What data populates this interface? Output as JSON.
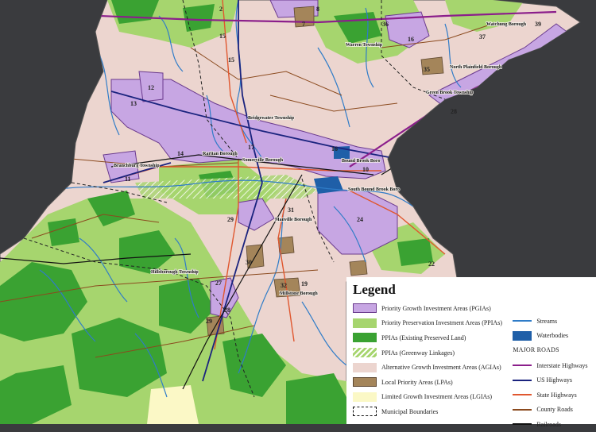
{
  "municipalities": [
    {
      "name": "Warren Township"
    },
    {
      "name": "Watchung Borough"
    },
    {
      "name": "North Plainfield Borough"
    },
    {
      "name": "Green Brook Township"
    },
    {
      "name": "Bridgewater Township"
    },
    {
      "name": "Raritan Borough"
    },
    {
      "name": "Somerville Borough"
    },
    {
      "name": "Bound Brook Boro"
    },
    {
      "name": "South Bound Brook Boro"
    },
    {
      "name": "Branchburg Township"
    },
    {
      "name": "Manville Borough"
    },
    {
      "name": "Hillsborough Township"
    },
    {
      "name": "Millstone Borough"
    }
  ],
  "route_markers": [
    "2",
    "8",
    "7",
    "36",
    "16",
    "37",
    "39",
    "15",
    "15",
    "12",
    "13",
    "35",
    "28",
    "17",
    "16",
    "10",
    "14",
    "11",
    "31",
    "24",
    "29",
    "30",
    "27",
    "32",
    "19",
    "22",
    "28",
    "29"
  ],
  "colors": {
    "pgia": "#c7a6e3",
    "ppia": "#a6d56e",
    "ppia_preserved": "#3aa232",
    "agia": "#ecd5cf",
    "lpa": "#a4855a",
    "lgia": "#fbf8c6",
    "streams": "#2f7cc8",
    "waterbodies": "#1f5fa8",
    "interstate": "#8b1e8b",
    "us_highway": "#1a237e",
    "state_highway": "#e0572f",
    "county_road": "#8b4a1e",
    "railroad": "#111111"
  },
  "legend": {
    "title": "Legend",
    "items": [
      {
        "label": "Priority Growth Investment Areas (PGIAs)",
        "icon": "pgia-swatch"
      },
      {
        "label": "Priority Preservation Investment Areas (PPIAs)",
        "icon": "ppia-swatch"
      },
      {
        "label": "PPIAs (Existing Preserved Land)",
        "icon": "ppia-preserved-swatch"
      },
      {
        "label": "PPIAs (Greenway Linkages)",
        "icon": "ppia-greenway-swatch"
      },
      {
        "label": "Alternative Growth Investment Areas (AGIAs)",
        "icon": "agia-swatch"
      },
      {
        "label": "Local Priority Areas (LPAs)",
        "icon": "lpa-swatch"
      },
      {
        "label": "Limited Growth Investment Areas (LGIAs)",
        "icon": "lgia-swatch"
      },
      {
        "label": "Municipal Boundaries",
        "icon": "municipal-boundary-swatch"
      }
    ],
    "water": [
      {
        "label": "Streams",
        "icon": "stream-line"
      },
      {
        "label": "Waterbodies",
        "icon": "waterbody-swatch"
      }
    ],
    "roads_heading": "MAJOR ROADS",
    "roads": [
      {
        "label": "Interstate Highways",
        "icon": "interstate-line"
      },
      {
        "label": "US Highways",
        "icon": "us-highway-line"
      },
      {
        "label": "State Highways",
        "icon": "state-highway-line"
      },
      {
        "label": "County Roads",
        "icon": "county-road-line"
      },
      {
        "label": "Railroads",
        "icon": "railroad-line"
      }
    ]
  }
}
